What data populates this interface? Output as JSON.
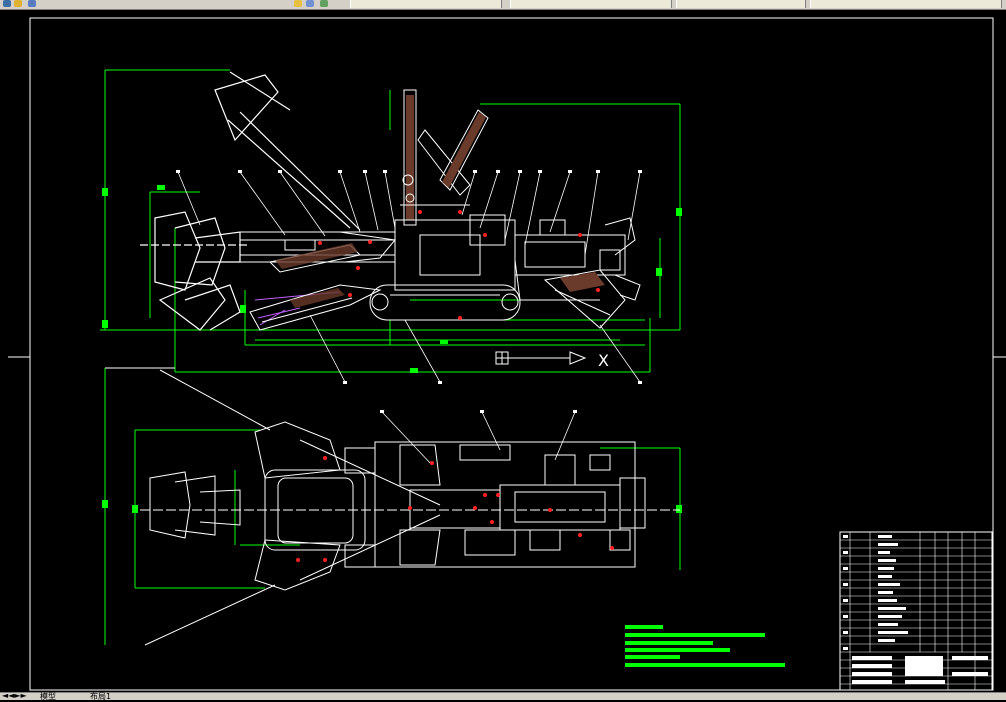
{
  "window": {
    "tabs": [
      "",
      "",
      "",
      "",
      ""
    ],
    "layout_tabs": [
      "模型",
      "布局1"
    ]
  },
  "drawing": {
    "type": "CAD engineering drawing",
    "views": [
      "side-view",
      "top-view"
    ],
    "colors": {
      "background": "#000000",
      "frame": "#ffffff",
      "dimension": "#00ff00",
      "component": "#ffffff",
      "hidden_part": "#c060ff",
      "mark": "#ff2020",
      "hatch": "#6a3a2a"
    },
    "axis_marker": "X",
    "notes_lines": 6,
    "title_block_rows": 18
  }
}
